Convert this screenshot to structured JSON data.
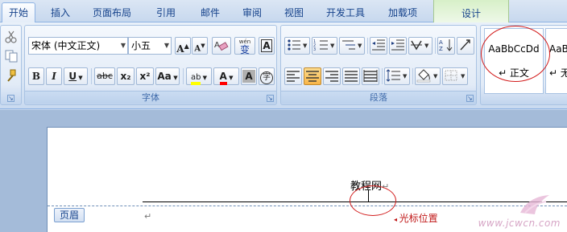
{
  "tabs": [
    "开始",
    "插入",
    "页面布局",
    "引用",
    "邮件",
    "审阅",
    "视图",
    "开发工具",
    "加载项",
    "设计"
  ],
  "font_group": {
    "label": "字体",
    "font_name": "宋体 (中文正文)",
    "font_size": "小五",
    "grow_font": "A",
    "shrink_font": "A",
    "phonetic": "wén",
    "phonetic_char": "变",
    "border_char": "A",
    "bold": "B",
    "italic": "I",
    "underline": "U",
    "strike": "abc",
    "subscript": "x₂",
    "superscript": "x²",
    "change_case": "Aa",
    "highlight": "ab",
    "font_color": "A",
    "char_shading": "A",
    "enclose_char": "字"
  },
  "paragraph_group": {
    "label": "段落"
  },
  "styles_group": {
    "items": [
      {
        "sample": "AaBbCcDd",
        "name": "↵ 正文"
      },
      {
        "sample": "AaB",
        "name": "↵ 无"
      }
    ]
  },
  "document": {
    "header_text": "教程网",
    "para_mark": "↵",
    "header_tag": "页眉",
    "body_para_mark": "↵"
  },
  "annotation": {
    "label": "光标位置"
  },
  "watermark": "www.jcwcn.com",
  "colors": {
    "highlight_yellow": "#ffff00",
    "font_red": "#ff0000",
    "annotation_red": "#d21b1b"
  }
}
